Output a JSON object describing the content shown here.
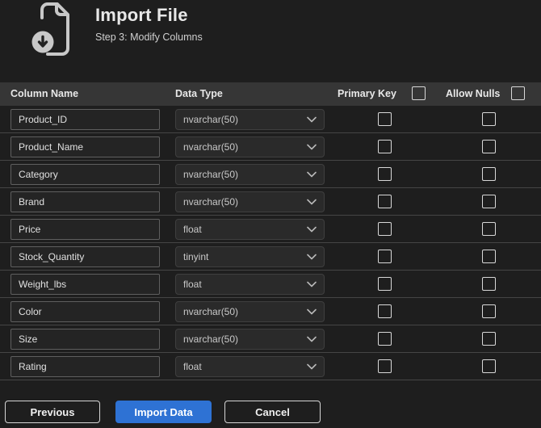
{
  "header": {
    "title": "Import File",
    "subtitle": "Step 3: Modify Columns",
    "icon": "import-file-icon"
  },
  "table": {
    "headers": {
      "column_name": "Column Name",
      "data_type": "Data Type",
      "primary_key": "Primary Key",
      "allow_nulls": "Allow Nulls"
    },
    "header_checkboxes": {
      "primary_key_all_checked": false,
      "allow_nulls_all_checked": false
    },
    "rows": [
      {
        "name": "Product_ID",
        "type": "nvarchar(50)",
        "primary_key": false,
        "allow_nulls": false
      },
      {
        "name": "Product_Name",
        "type": "nvarchar(50)",
        "primary_key": false,
        "allow_nulls": false
      },
      {
        "name": "Category",
        "type": "nvarchar(50)",
        "primary_key": false,
        "allow_nulls": false
      },
      {
        "name": "Brand",
        "type": "nvarchar(50)",
        "primary_key": false,
        "allow_nulls": false
      },
      {
        "name": "Price",
        "type": "float",
        "primary_key": false,
        "allow_nulls": false
      },
      {
        "name": "Stock_Quantity",
        "type": "tinyint",
        "primary_key": false,
        "allow_nulls": false
      },
      {
        "name": "Weight_lbs",
        "type": "float",
        "primary_key": false,
        "allow_nulls": false
      },
      {
        "name": "Color",
        "type": "nvarchar(50)",
        "primary_key": false,
        "allow_nulls": false
      },
      {
        "name": "Size",
        "type": "nvarchar(50)",
        "primary_key": false,
        "allow_nulls": false
      },
      {
        "name": "Rating",
        "type": "float",
        "primary_key": false,
        "allow_nulls": false
      }
    ]
  },
  "buttons": {
    "previous": "Previous",
    "import": "Import Data",
    "cancel": "Cancel"
  },
  "colors": {
    "accent_blue": "#2e72d4",
    "background": "#1e1e1e",
    "header_band": "#363636"
  }
}
